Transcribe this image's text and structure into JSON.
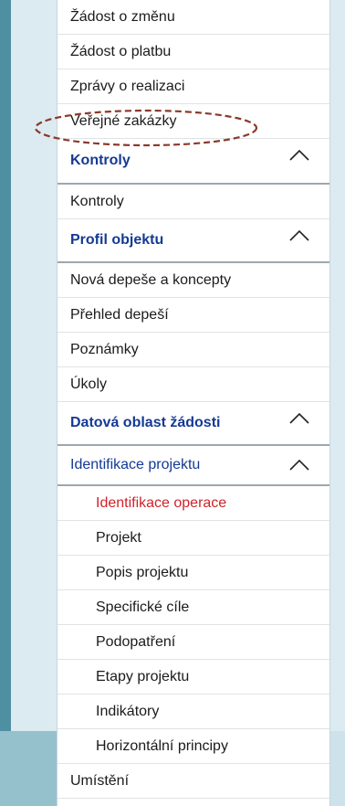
{
  "menu": {
    "top": [
      {
        "label": "Žádost o změnu"
      },
      {
        "label": "Žádost o platbu"
      },
      {
        "label": "Zprávy o realizaci"
      },
      {
        "label": "Veřejné zakázky"
      }
    ],
    "kontroly": {
      "section_label": "Kontroly",
      "items": [
        {
          "label": "Kontroly"
        }
      ]
    },
    "profil": {
      "section_label": "Profil objektu",
      "items": [
        {
          "label": "Nová depeše a koncepty"
        },
        {
          "label": "Přehled depeší"
        },
        {
          "label": "Poznámky"
        },
        {
          "label": "Úkoly"
        }
      ]
    },
    "datova": {
      "section_label": "Datová oblast žádosti",
      "identifikace": {
        "label": "Identifikace projektu",
        "children": [
          {
            "label": "Identifikace operace",
            "active": true
          },
          {
            "label": "Projekt"
          },
          {
            "label": "Popis projektu"
          },
          {
            "label": "Specifické cíle"
          },
          {
            "label": "Podopatření"
          },
          {
            "label": "Etapy projektu"
          },
          {
            "label": "Indikátory"
          },
          {
            "label": "Horizontální principy"
          }
        ]
      },
      "after": [
        {
          "label": "Umístění"
        }
      ]
    }
  },
  "colors": {
    "section_text": "#143a94",
    "active_text": "#d0222b",
    "highlight_ellipse": "#8b3a2a"
  },
  "icons": {
    "collapse": "chevron-up-icon"
  }
}
